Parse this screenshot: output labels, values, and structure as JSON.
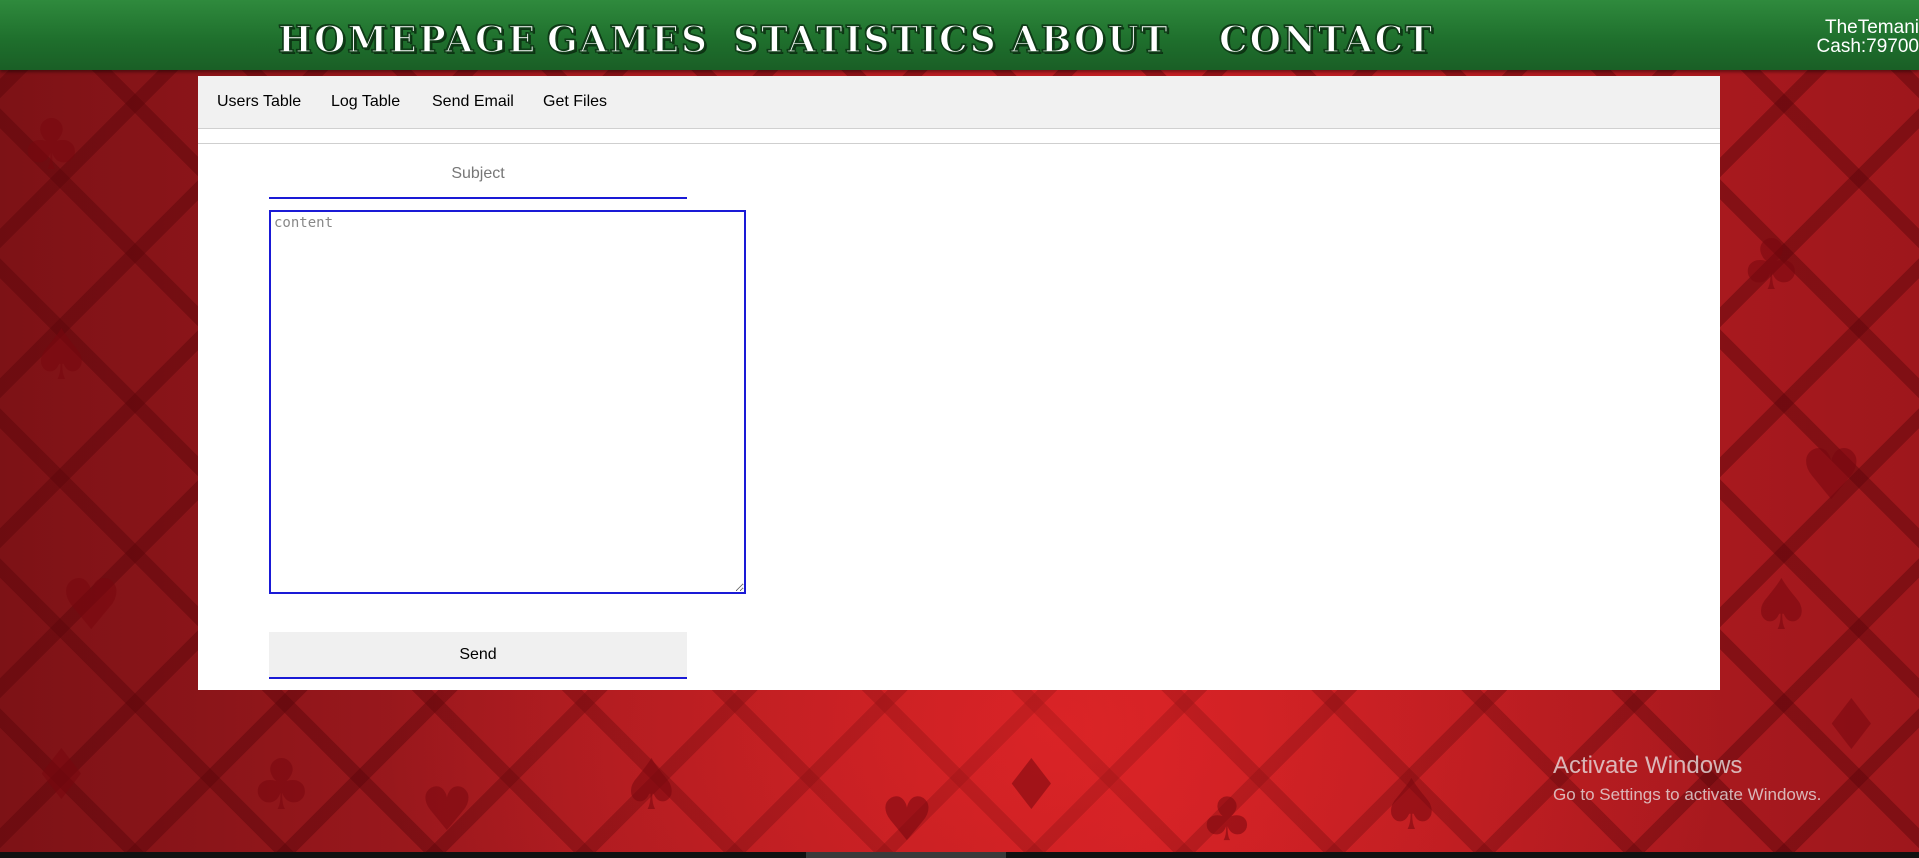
{
  "nav": {
    "items": [
      {
        "label": "HOMEPAGE"
      },
      {
        "label": "GAMES"
      },
      {
        "label": "STATISTICS"
      },
      {
        "label": "ABOUT"
      },
      {
        "label": "CONTACT"
      }
    ],
    "colors": {
      "bar": "#2a7a36",
      "text": "#ffffff"
    }
  },
  "user": {
    "name": "TheTemani",
    "cash": "Cash:79700"
  },
  "tabs": {
    "items": [
      {
        "label": "Users Table"
      },
      {
        "label": "Log Table"
      },
      {
        "label": "Send Email"
      },
      {
        "label": "Get Files"
      }
    ]
  },
  "form": {
    "subject_placeholder": "Subject",
    "subject_value": "",
    "content_placeholder": "content",
    "content_value": "",
    "send_label": "Send",
    "accent": "#1a1ad6"
  },
  "watermark": {
    "title": "Activate Windows",
    "subtitle": "Go to Settings to activate Windows."
  },
  "background": {
    "theme": "red-playing-card-suits",
    "suit_icons": [
      "club-icon",
      "spade-icon",
      "heart-icon",
      "diamond-icon"
    ]
  }
}
